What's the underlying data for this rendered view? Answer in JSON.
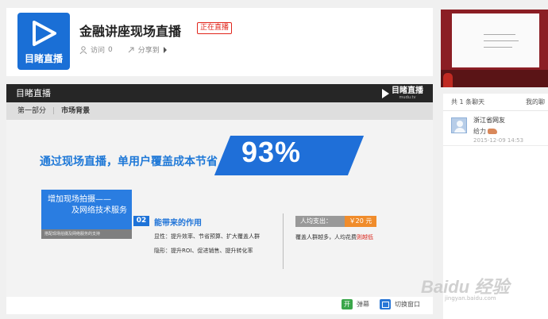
{
  "header": {
    "logo_text": "目睹直播",
    "title": "金融讲座现场直播",
    "live_badge": "正在直播",
    "visits_label": "访问",
    "visits_count": "0",
    "share_label": "分享到"
  },
  "player": {
    "bar_title": "目睹直播",
    "brand_text": "目睹直播",
    "brand_sub": "mudu.tv",
    "crumb_part": "第一部分",
    "crumb_section": "市场背景",
    "slide": {
      "headline": "通过现场直播，单用户覆盖成本节省",
      "percent": "93%",
      "box_line1": "增加现场拍摄——",
      "box_line2": "及网络技术服务",
      "box_sub": "搭配现场拍摄及网络服务的支持",
      "num": "02",
      "effect_title": "能带来的作用",
      "effect_line1": "显性：提升效率、节省预算、扩大覆盖人群",
      "effect_line2": "隐形：提升ROI、促进销售、提升转化率",
      "cost_label": "人均支出：",
      "cost_value": "￥20 元",
      "cost_desc_a": "覆盖人群越多，人均花费",
      "cost_desc_b": "则越低"
    },
    "footer_btn1_icon": "开",
    "footer_btn1": "弹幕",
    "footer_btn2": "切换窗口"
  },
  "chat": {
    "count_text": "共 1 条聊天",
    "right_label": "我的聊",
    "messages": [
      {
        "user": "浙江省网友",
        "text": "给力",
        "time": "2015-12-09 14:53"
      }
    ]
  },
  "watermark": {
    "main": "Baidu 经验",
    "sub": "jingyan.baidu.com"
  },
  "colors": {
    "brand_blue": "#1a6fd6",
    "live_red": "#e1251b",
    "cost_orange": "#f08c2b"
  }
}
